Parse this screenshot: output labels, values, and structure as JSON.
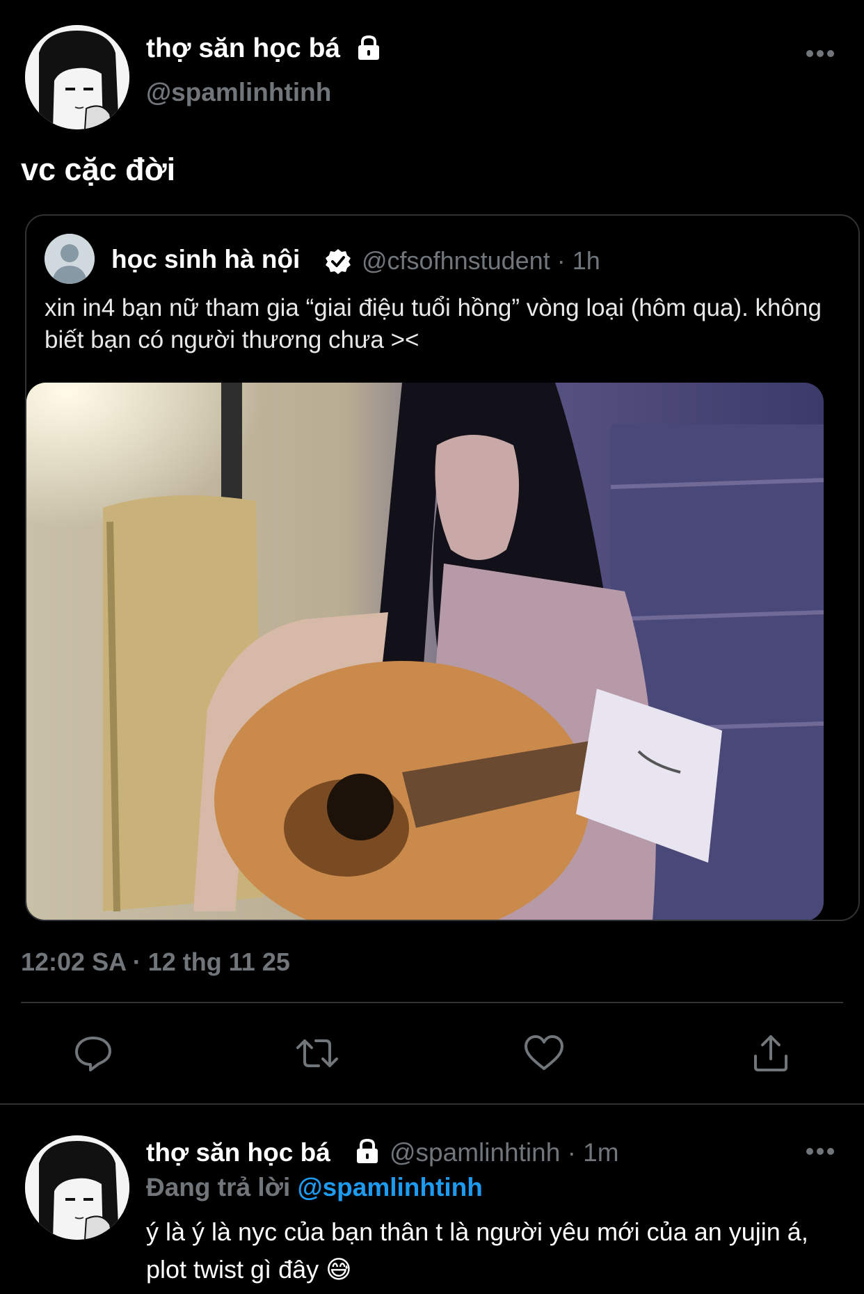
{
  "tweet": {
    "author_name": "thợ săn học bá",
    "author_handle": "@spamlinhtinh",
    "text": "vc cặc đời",
    "timestamp": "12:02 SA · 12 thg 11 25"
  },
  "quote": {
    "author_name": "học sinh hà nội",
    "author_handle_time": "@cfsofhnstudent · 1h",
    "text": "xin in4 bạn nữ tham gia “giai điệu tuổi hồng” vòng loại (hôm qua). không biết bạn có người thương chưa ><",
    "media_alt": "girl with long black hair playing acoustic guitar"
  },
  "actions": [
    "reply-icon",
    "retweet-icon",
    "like-icon",
    "share-icon"
  ],
  "reply": {
    "author_name": "thợ săn học bá",
    "author_handle_time": "@spamlinhtinh · 1m",
    "replying_label": "Đang trả lời",
    "replying_mention": "@spamlinhtinh",
    "text": "ý là ý là nyc của bạn thân t là người yêu mới của an yujin á, plot twist gì đây 😅"
  },
  "colors": {
    "background": "#000000",
    "secondary_text": "#71767b",
    "mention": "#1d9bf0",
    "divider": "#2f3336"
  }
}
